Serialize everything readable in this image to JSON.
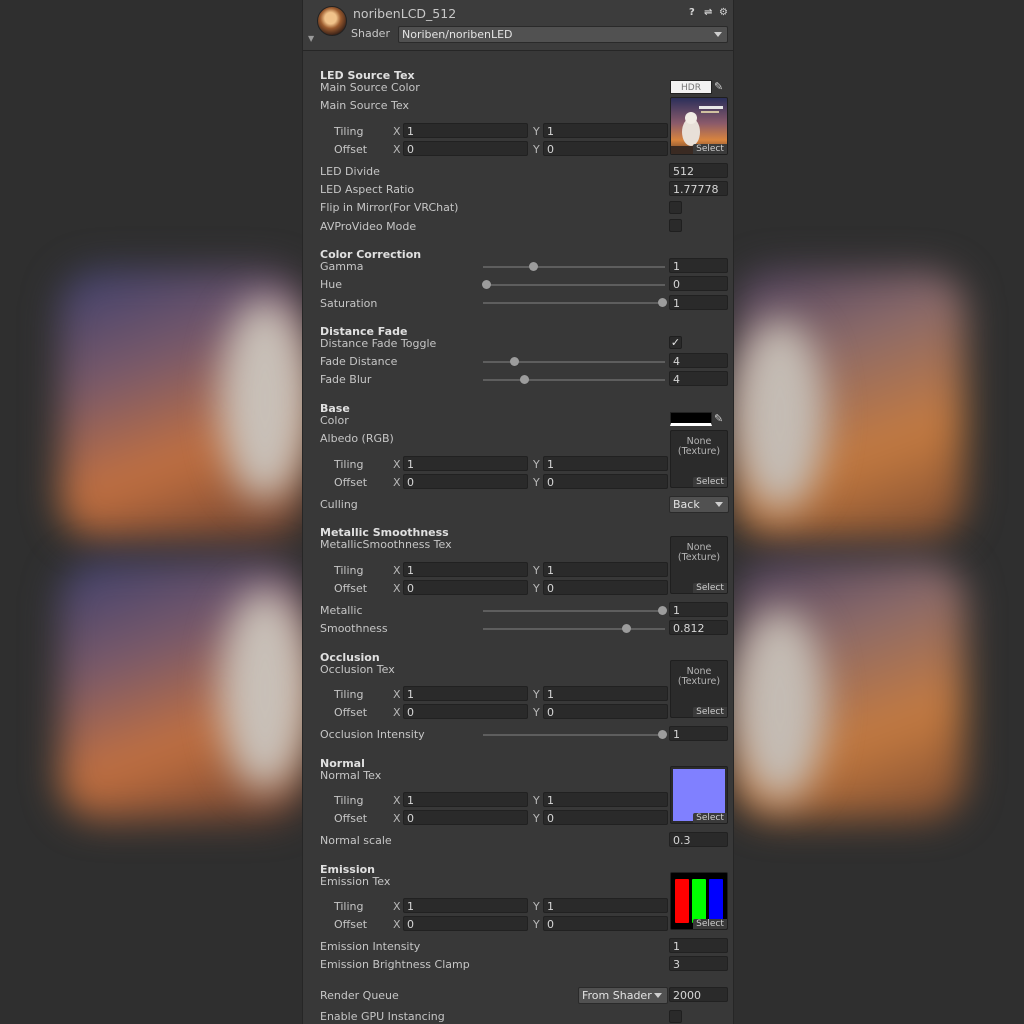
{
  "header": {
    "material_name": "noribenLCD_512",
    "shader_label": "Shader",
    "shader_value": "Noriben/noribenLED"
  },
  "colors": {
    "panel": "#383838",
    "field": "#2a2a2a",
    "text": "#c6c6c6",
    "normal_map": "#8080ff"
  },
  "common": {
    "tiling": "Tiling",
    "offset": "Offset",
    "x": "X",
    "y": "Y",
    "select": "Select",
    "none": "None",
    "texture": "(Texture)",
    "hdr": "HDR"
  },
  "led_source": {
    "title": "LED Source Tex",
    "main_source_color": "Main Source Color",
    "main_source_tex": "Main Source Tex",
    "tiling_x": "1",
    "tiling_y": "1",
    "offset_x": "0",
    "offset_y": "0",
    "led_divide_label": "LED Divide",
    "led_divide": "512",
    "aspect_label": "LED Aspect Ratio",
    "aspect": "1.77778",
    "flip_label": "Flip in Mirror(For VRChat)",
    "flip_checked": false,
    "avpro_label": "AVProVideo Mode",
    "avpro_checked": false
  },
  "color_correction": {
    "title": "Color Correction",
    "gamma_label": "Gamma",
    "gamma": "1",
    "gamma_pos": 0.27,
    "hue_label": "Hue",
    "hue": "0",
    "hue_pos": 0.0,
    "saturation_label": "Saturation",
    "saturation": "1",
    "saturation_pos": 1.0
  },
  "distance_fade": {
    "title": "Distance Fade",
    "toggle_label": "Distance Fade Toggle",
    "toggle_checked": true,
    "distance_label": "Fade Distance",
    "distance": "4",
    "distance_pos": 0.16,
    "blur_label": "Fade Blur",
    "blur": "4",
    "blur_pos": 0.22
  },
  "base": {
    "title": "Base",
    "color_label": "Color",
    "albedo_label": "Albedo (RGB)",
    "tiling_x": "1",
    "tiling_y": "1",
    "offset_x": "0",
    "offset_y": "0",
    "culling_label": "Culling",
    "culling": "Back"
  },
  "metallic": {
    "title": "Metallic Smoothness",
    "tex_label": "MetallicSmoothness Tex",
    "tiling_x": "1",
    "tiling_y": "1",
    "offset_x": "0",
    "offset_y": "0",
    "metallic_label": "Metallic",
    "metallic": "1",
    "metallic_pos": 1.0,
    "smoothness_label": "Smoothness",
    "smoothness": "0.812",
    "smoothness_pos": 0.8
  },
  "occlusion": {
    "title": "Occlusion",
    "tex_label": "Occlusion Tex",
    "tiling_x": "1",
    "tiling_y": "1",
    "offset_x": "0",
    "offset_y": "0",
    "intensity_label": "Occlusion Intensity",
    "intensity": "1",
    "intensity_pos": 1.0
  },
  "normal": {
    "title": "Normal",
    "tex_label": "Normal Tex",
    "tiling_x": "1",
    "tiling_y": "1",
    "offset_x": "0",
    "offset_y": "0",
    "scale_label": "Normal scale",
    "scale": "0.3"
  },
  "emission": {
    "title": "Emission",
    "tex_label": "Emission Tex",
    "tiling_x": "1",
    "tiling_y": "1",
    "offset_x": "0",
    "offset_y": "0",
    "intensity_label": "Emission Intensity",
    "intensity": "1",
    "clamp_label": "Emission Brightness Clamp",
    "clamp": "3"
  },
  "footer": {
    "render_queue_label": "Render Queue",
    "render_queue_mode": "From Shader",
    "render_queue": "2000",
    "gpu_instancing_label": "Enable GPU Instancing",
    "gpu_instancing_checked": false
  }
}
